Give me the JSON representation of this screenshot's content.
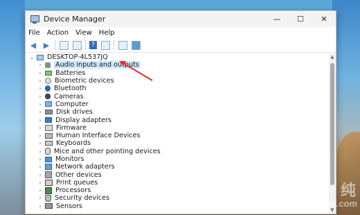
{
  "window": {
    "title": "Device Manager",
    "controls": {
      "minimize": "—",
      "maximize": "☐",
      "close": "✕"
    }
  },
  "menu": [
    "File",
    "Action",
    "View",
    "Help"
  ],
  "toolbar_icons": [
    "back-arrow-icon",
    "forward-arrow-icon",
    "properties-icon",
    "grid-icon",
    "help-icon",
    "list-icon",
    "scan-icon",
    "monitor-icon"
  ],
  "tree": {
    "root": "DESKTOP-4L537JQ",
    "items": [
      {
        "label": "Audio inputs and outputs",
        "icon": "audio-icon"
      },
      {
        "label": "Batteries",
        "icon": "battery-icon"
      },
      {
        "label": "Biometric devices",
        "icon": "biometric-icon"
      },
      {
        "label": "Bluetooth",
        "icon": "bluetooth-icon"
      },
      {
        "label": "Cameras",
        "icon": "camera-icon"
      },
      {
        "label": "Computer",
        "icon": "computer-icon"
      },
      {
        "label": "Disk drives",
        "icon": "disk-icon"
      },
      {
        "label": "Display adapters",
        "icon": "display-adapter-icon"
      },
      {
        "label": "Firmware",
        "icon": "firmware-icon"
      },
      {
        "label": "Human Interface Devices",
        "icon": "hid-icon"
      },
      {
        "label": "Keyboards",
        "icon": "keyboard-icon"
      },
      {
        "label": "Mice and other pointing devices",
        "icon": "mouse-icon"
      },
      {
        "label": "Monitors",
        "icon": "monitor-icon"
      },
      {
        "label": "Network adapters",
        "icon": "network-icon"
      },
      {
        "label": "Other devices",
        "icon": "other-devices-icon"
      },
      {
        "label": "Print queues",
        "icon": "printer-icon"
      },
      {
        "label": "Processors",
        "icon": "processor-icon"
      },
      {
        "label": "Security devices",
        "icon": "security-icon"
      },
      {
        "label": "Sensors",
        "icon": "sensor-icon"
      }
    ]
  },
  "watermark": {
    "cn": "纯",
    "text": "DaDiGhost.com"
  }
}
